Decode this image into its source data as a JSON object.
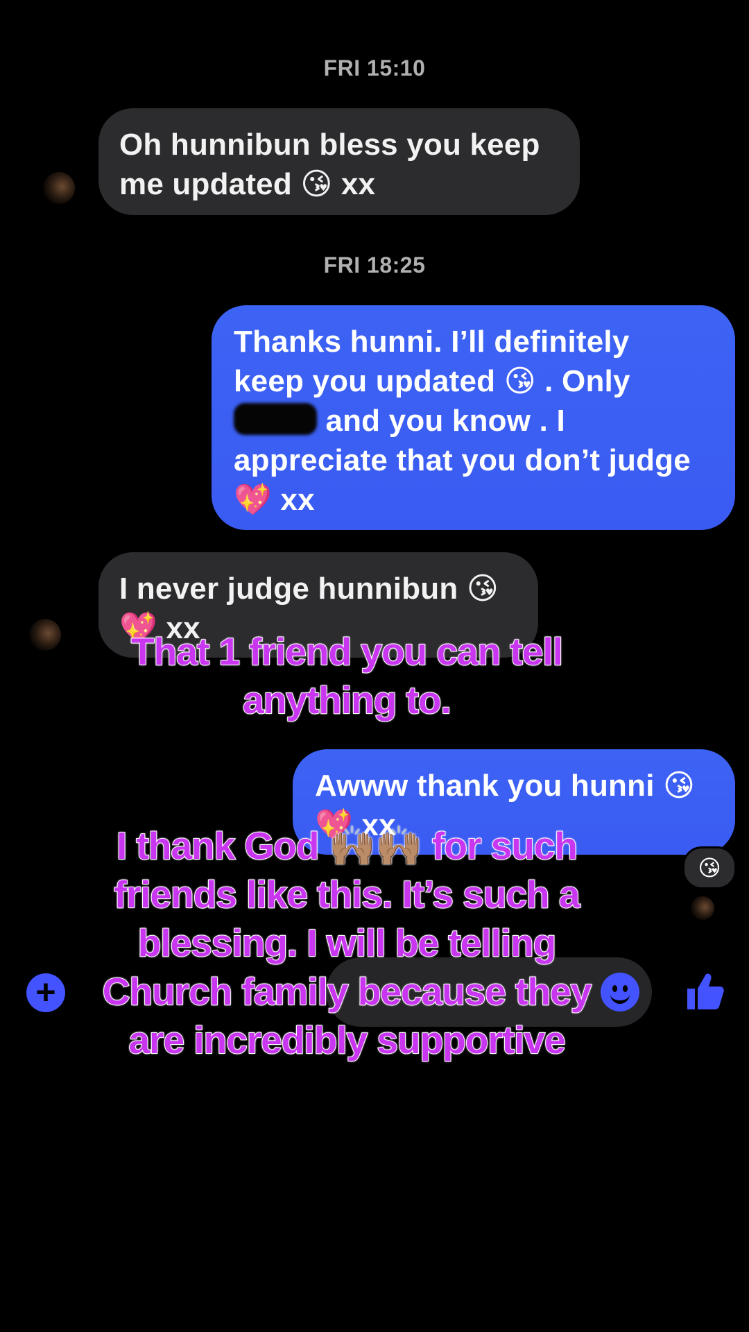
{
  "chat": {
    "timestamp_1": "FRI 15:10",
    "timestamp_2": "FRI 18:25",
    "messages": [
      {
        "direction": "incoming",
        "text_lines": [
          "Oh hunnibun bless you keep",
          "me updated 😘 xx"
        ]
      },
      {
        "direction": "outgoing",
        "line1": "Thanks hunni. I’ll definitely",
        "line2": "keep you updated 😘 . Only",
        "line3_after_redaction": "and you know . I",
        "line4": "appreciate that you don’t judge",
        "line5": "💖 xx"
      },
      {
        "direction": "incoming",
        "line1": "I never judge hunnibun 😘",
        "line2": "💖 xx"
      },
      {
        "direction": "outgoing",
        "line1": "Awww thank you hunni 😘",
        "line2": "💖 xx"
      }
    ],
    "reaction": "😘"
  },
  "composer": {
    "plus_icon": "plus-icon",
    "emoji_icon": "smiley-icon",
    "like_icon": "thumbs-up-icon",
    "accent_color": "#4353ff"
  },
  "overlay": {
    "caption_1_line1": "That 1 friend you can tell",
    "caption_1_line2": "anything to.",
    "caption_2_line1": "I thank God 🙌🏽🙌🏽 for such",
    "caption_2_line2": "friends like this. It’s such a",
    "caption_2_line3": "blessing. I will be telling",
    "caption_2_line4": "Church family because they",
    "caption_2_line5": "are incredibly supportive",
    "caption_color": "#c936f0"
  }
}
